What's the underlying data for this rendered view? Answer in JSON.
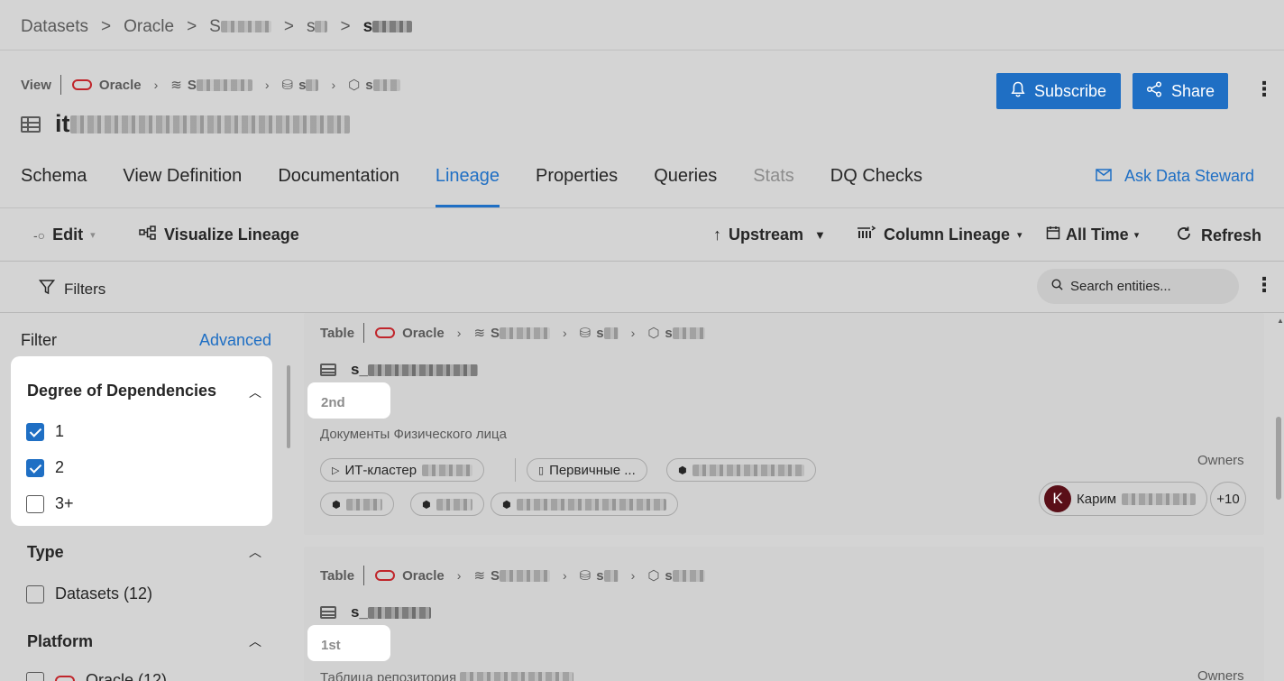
{
  "top_breadcrumb": {
    "items": [
      "Datasets",
      "Oracle",
      "S",
      "s",
      "s"
    ]
  },
  "header": {
    "type_label": "View",
    "platform": "Oracle",
    "path": [
      "S",
      "s",
      "s"
    ],
    "title": "it",
    "subscribe_label": "Subscribe",
    "share_label": "Share"
  },
  "tabs": [
    {
      "label": "Schema"
    },
    {
      "label": "View Definition"
    },
    {
      "label": "Documentation"
    },
    {
      "label": "Lineage"
    },
    {
      "label": "Properties"
    },
    {
      "label": "Queries"
    },
    {
      "label": "Stats"
    },
    {
      "label": "DQ Checks"
    }
  ],
  "ask_label": "Ask Data Steward",
  "toolbar": {
    "edit": "Edit",
    "visualize": "Visualize Lineage",
    "upstream": "Upstream",
    "column_lineage": "Column Lineage",
    "time": "All Time",
    "refresh": "Refresh"
  },
  "filters_label": "Filters",
  "search": {
    "placeholder": "Search entities..."
  },
  "sidebar": {
    "filter_label": "Filter",
    "advanced_label": "Advanced",
    "degree": {
      "title": "Degree of Dependencies",
      "options": [
        {
          "label": "1",
          "checked": true
        },
        {
          "label": "2",
          "checked": true
        },
        {
          "label": "3+",
          "checked": false
        }
      ]
    },
    "type": {
      "title": "Type",
      "options": [
        {
          "label": "Datasets (12)",
          "checked": false
        }
      ]
    },
    "platform": {
      "title": "Platform",
      "options": [
        {
          "label": "Oracle (12)",
          "checked": false
        }
      ]
    }
  },
  "results": [
    {
      "type_label": "Table",
      "platform": "Oracle",
      "path": [
        "S",
        "s",
        "s"
      ],
      "name": "s_",
      "degree": "2nd",
      "description": "Документы Физического лица",
      "chips": [
        "ИТ-кластер",
        "Первичные ..."
      ],
      "owners_label": "Owners",
      "owner": {
        "initial": "K",
        "name": "Карим"
      },
      "more_owners": "+10"
    },
    {
      "type_label": "Table",
      "platform": "Oracle",
      "path": [
        "S",
        "s",
        "s"
      ],
      "name": "s_",
      "degree": "1st",
      "description": "Таблица репозитория",
      "owners_label": "Owners"
    }
  ],
  "colors": {
    "accent": "#1f6fc4",
    "oracle": "#c0252b",
    "avatar": "#5a0f18"
  }
}
